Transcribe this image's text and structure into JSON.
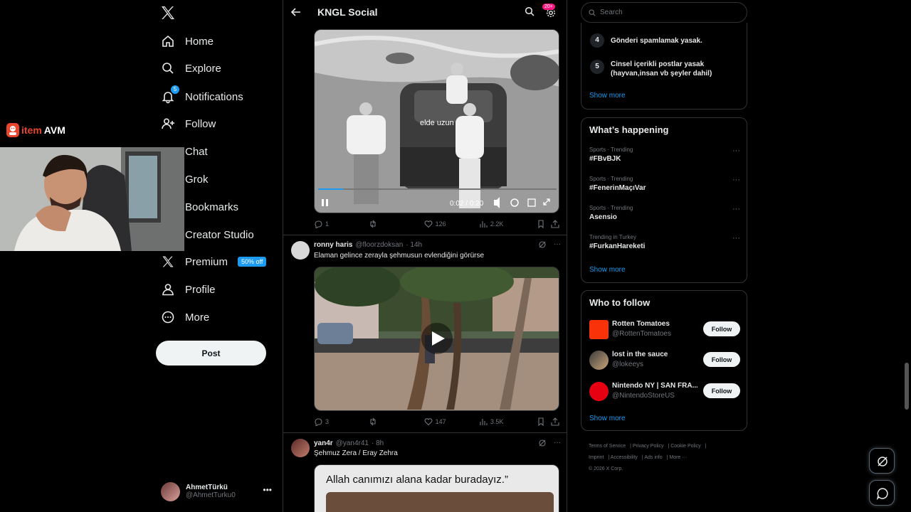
{
  "nav": {
    "items": [
      {
        "label": "Home",
        "icon": "home-icon"
      },
      {
        "label": "Explore",
        "icon": "search-icon"
      },
      {
        "label": "Notifications",
        "icon": "bell-icon",
        "badge": "5"
      },
      {
        "label": "Follow",
        "icon": "follow-icon"
      },
      {
        "label": "Chat",
        "icon": "chat-icon"
      },
      {
        "label": "Grok",
        "icon": "grok-icon"
      },
      {
        "label": "Bookmarks",
        "icon": "bookmark-icon"
      },
      {
        "label": "Creator Studio",
        "icon": "creator-icon"
      },
      {
        "label": "Premium",
        "icon": "x-icon",
        "badge": "50% off"
      },
      {
        "label": "Profile",
        "icon": "person-icon"
      },
      {
        "label": "More",
        "icon": "more-circle-icon"
      }
    ],
    "post_button": "Post",
    "account": {
      "name": "AhmetTürkü",
      "handle": "@AhmetTurku0"
    }
  },
  "overlay": {
    "brand_part1": "item",
    "brand_part2": "AVM"
  },
  "main": {
    "title": "KNGL Social",
    "settings_badge": "20+",
    "tweets": [
      {
        "caption_overlay": "elde uzun",
        "time": "0:02 / 0:20",
        "replies": "1",
        "reposts": "",
        "likes": "126",
        "views": "2.2K"
      },
      {
        "name": "ronny haris",
        "handle": "@floorzdoksan",
        "age": "· 14h",
        "text": "Elaman gelince zerayla şehmusun evlendiğini görürse",
        "replies": "3",
        "reposts": "",
        "likes": "147",
        "views": "3.5K"
      },
      {
        "name": "yan4r",
        "handle": "@yan4r41",
        "age": "· 8h",
        "text": "Şehmuz Zera / Eray Zehra",
        "image_caption": "Allah canımızı alana kadar buradayız.”"
      }
    ]
  },
  "right": {
    "search_placeholder": "Search",
    "rules": [
      {
        "num": "4",
        "text": "Gönderi spamlamak yasak."
      },
      {
        "num": "5",
        "text": "Cinsel içerikli postlar yasak (hayvan,insan vb şeyler dahil)"
      }
    ],
    "rules_show_more": "Show more",
    "happening": {
      "title": "What’s happening",
      "trends": [
        {
          "meta": "Sports · Trending",
          "name": "#FBvBJK"
        },
        {
          "meta": "Sports · Trending",
          "name": "#FenerinMaçıVar"
        },
        {
          "meta": "Sports · Trending",
          "name": "Asensio"
        },
        {
          "meta": "Trending in Turkey",
          "name": "#FurkanHareketi"
        }
      ],
      "show_more": "Show more"
    },
    "who_to_follow": {
      "title": "Who to follow",
      "accounts": [
        {
          "name": "Rotten Tomatoes",
          "handle": "@RottenTomatoes",
          "button": "Follow"
        },
        {
          "name": "lost in the sauce",
          "handle": "@lokeeys",
          "button": "Follow"
        },
        {
          "name": "Nintendo NY | SAN FRA...",
          "handle": "@NintendoStoreUS",
          "button": "Follow"
        }
      ],
      "show_more": "Show more"
    },
    "footer": {
      "links": [
        "Terms of Service",
        "Privacy Policy",
        "Cookie Policy",
        "Imprint",
        "Accessibility",
        "Ads info",
        "More ···"
      ],
      "copyright": "© 2026 X Corp."
    }
  },
  "colors": {
    "accent": "#1d9bf0",
    "background": "#000000",
    "text": "#e7e9ea",
    "muted": "#71767b",
    "border": "#2f3336",
    "brand": "#e8452c"
  }
}
